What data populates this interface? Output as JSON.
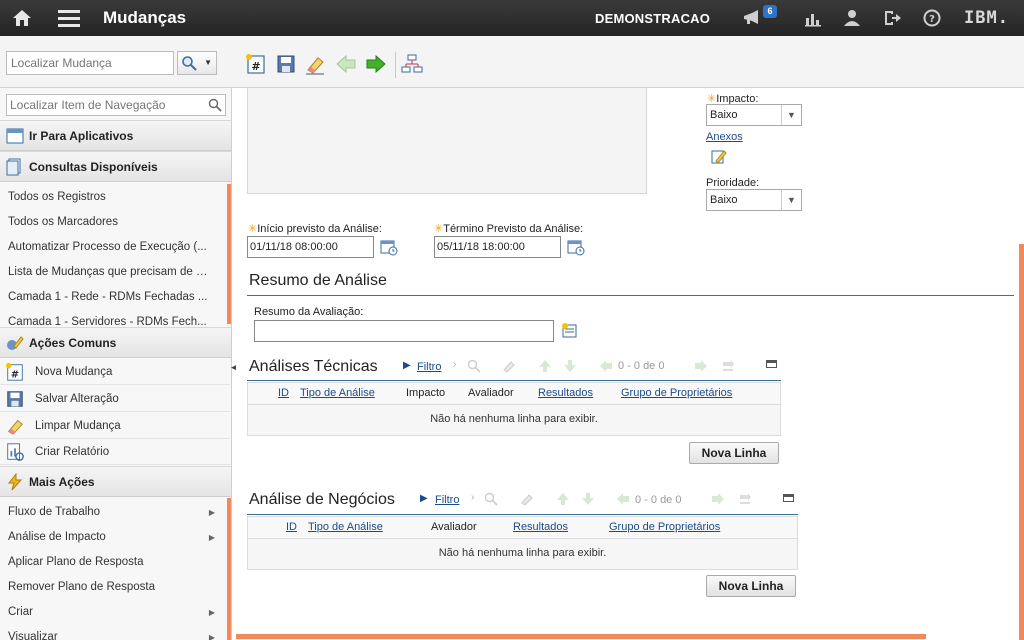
{
  "header": {
    "app_title": "Mudanças",
    "org": "DEMONSTRACAO",
    "notifications": "6",
    "logo": "IBM."
  },
  "toolbar": {
    "search_placeholder": "Localizar Mudança"
  },
  "sidebar": {
    "search_placeholder": "Localizar Item de Navegação",
    "goto_apps": "Ir Para Aplicativos",
    "queries_title": "Consultas Disponíveis",
    "queries": [
      "Todos os Registros",
      "Todos os Marcadores",
      "Automatizar Processo de Execução (...",
      "Lista de Mudanças que precisam de a...",
      "Camada 1 - Rede - RDMs Fechadas ...",
      "Camada 1 - Servidores - RDMs Fech..."
    ],
    "common_actions_title": "Ações Comuns",
    "common_actions": [
      "Nova Mudança",
      "Salvar Alteração",
      "Limpar Mudança",
      "Criar Relatório"
    ],
    "more_actions_title": "Mais Ações",
    "more_actions": [
      "Fluxo de Trabalho",
      "Análise de Impacto",
      "Aplicar Plano de Resposta",
      "Remover Plano de Resposta",
      "Criar",
      "Visualizar"
    ]
  },
  "form": {
    "impact_label": "Impacto:",
    "impact_value": "Baixo",
    "attachments_label": "Anexos",
    "priority_label": "Prioridade:",
    "priority_value": "Baixo",
    "start_label": "Início previsto da Análise:",
    "start_value": "01/11/18 08:00:00",
    "end_label": "Término Previsto da Análise:",
    "end_value": "05/11/18 18:00:00"
  },
  "summary": {
    "title": "Resumo de Análise",
    "eval_label": "Resumo da Avaliação:"
  },
  "tech_table": {
    "title": "Análises Técnicas",
    "filter": "Filtro",
    "pager": "0 - 0 de 0",
    "columns": [
      "ID",
      "Tipo de Análise",
      "Impacto",
      "Avaliador",
      "Resultados",
      "Grupo de Proprietários"
    ],
    "empty": "Não há nenhuma linha para exibir.",
    "new_row": "Nova Linha"
  },
  "biz_table": {
    "title": "Análise de Negócios",
    "filter": "Filtro",
    "pager": "0 - 0 de 0",
    "columns": [
      "ID",
      "Tipo de Análise",
      "Avaliador",
      "Resultados",
      "Grupo de Proprietários"
    ],
    "empty": "Não há nenhuma linha para exibir.",
    "new_row": "Nova Linha"
  }
}
